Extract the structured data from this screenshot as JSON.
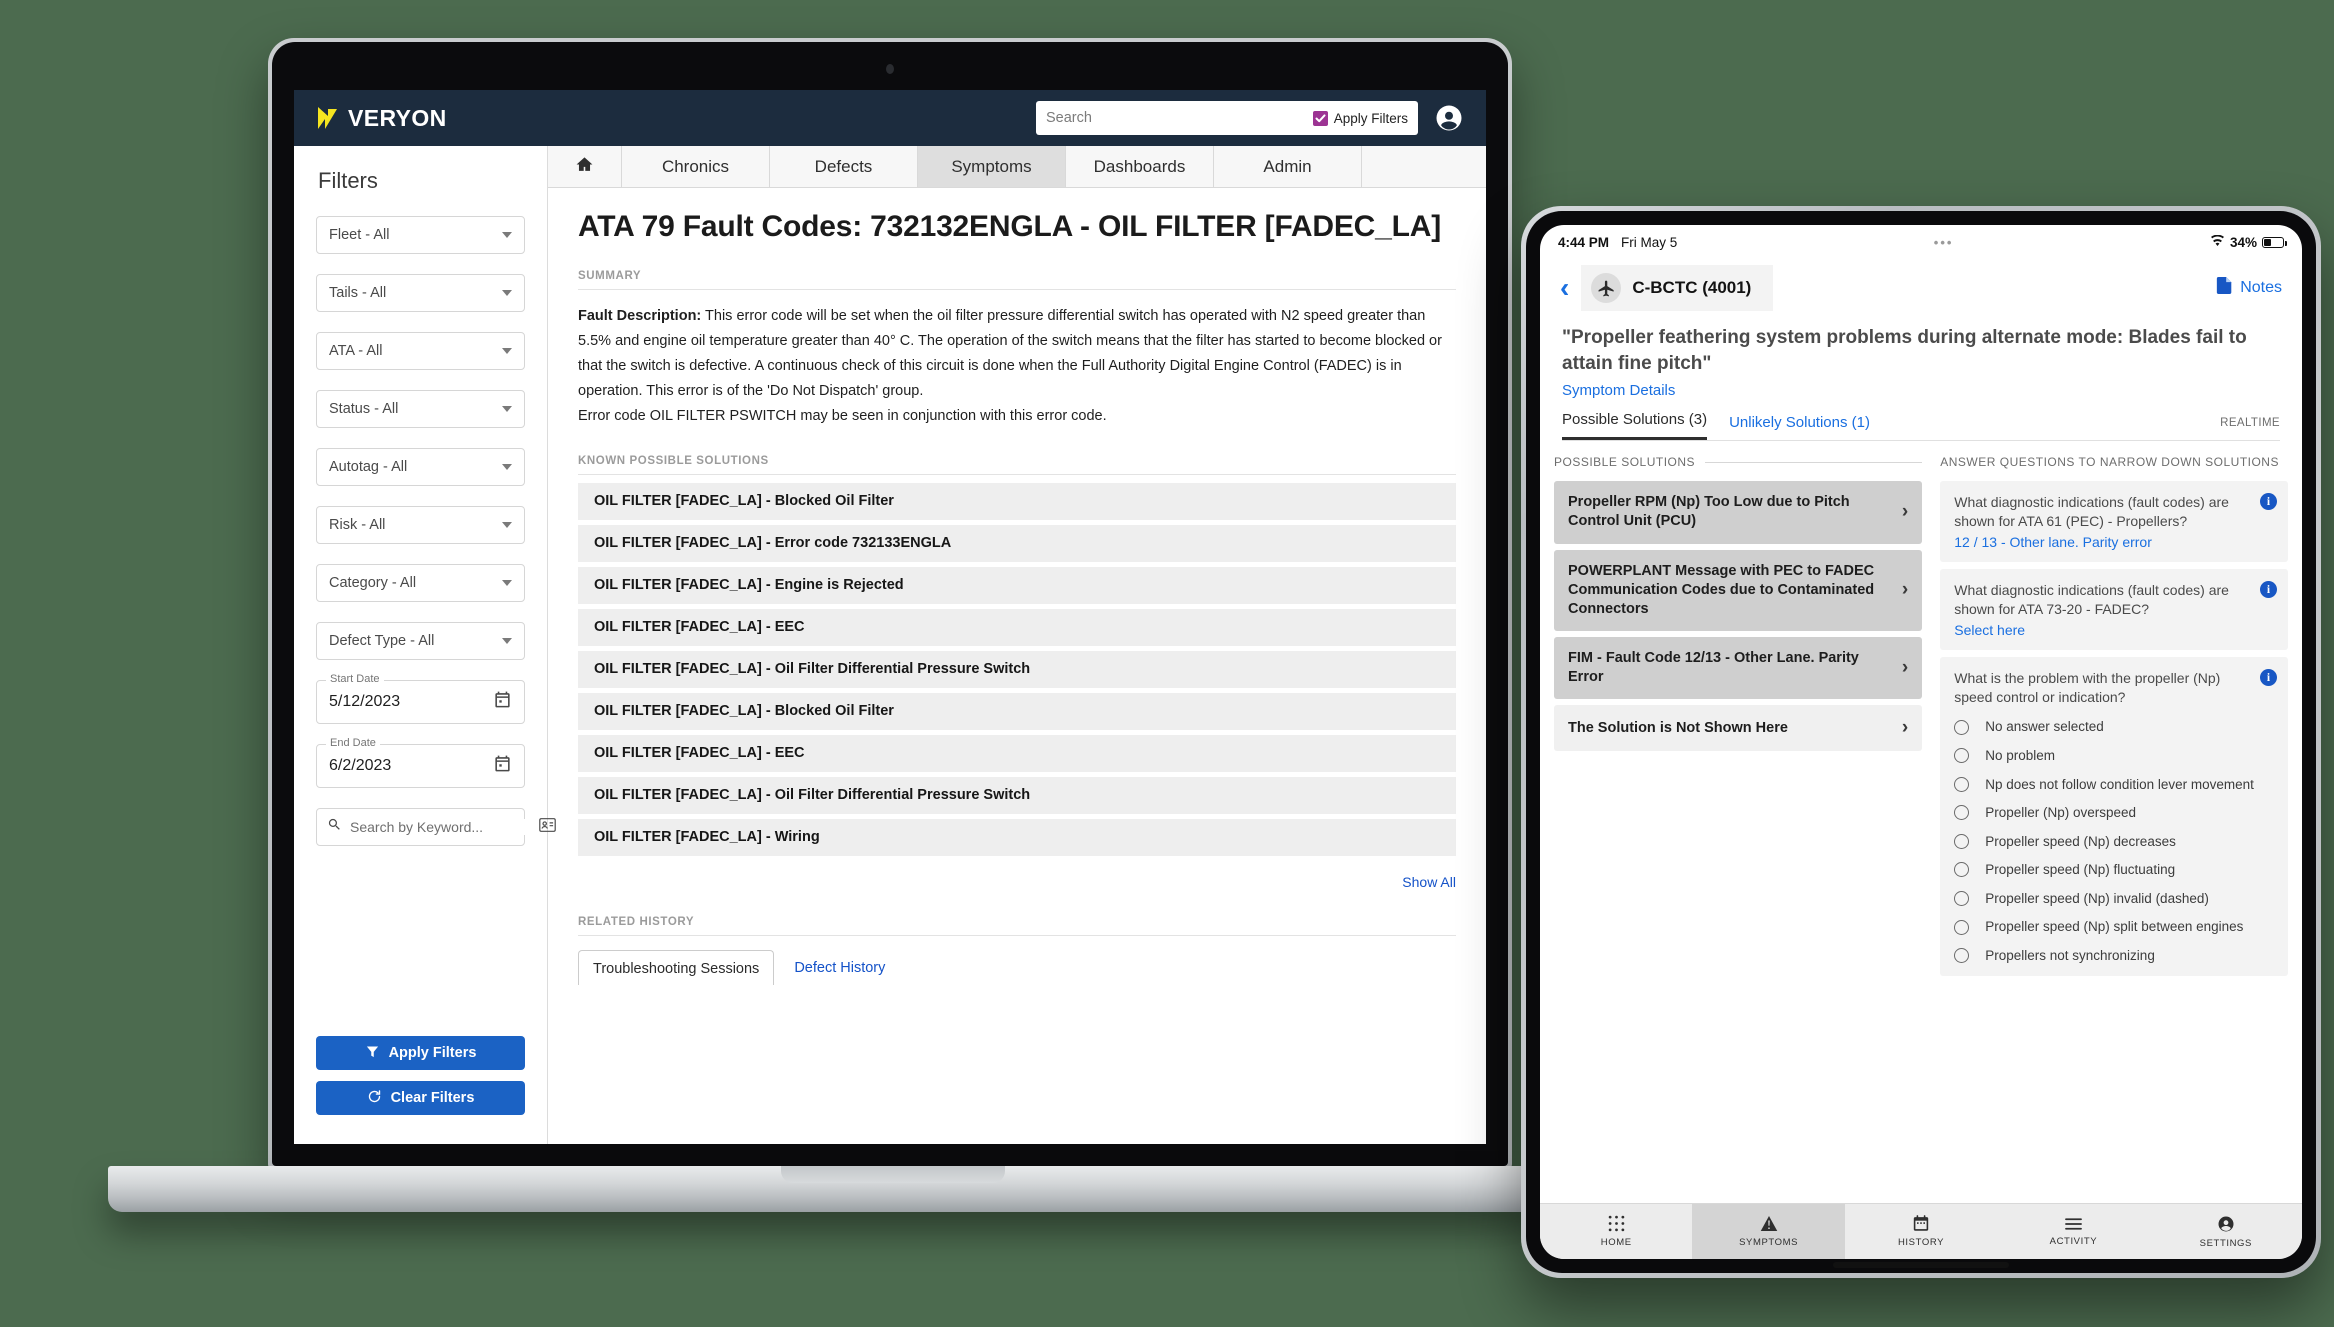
{
  "colors": {
    "background": "#4c6b4f",
    "topbar": "#1c2c3e",
    "brand_yellow": "#f5e520",
    "primary_blue": "#1b62c4",
    "link_blue": "#1452c8",
    "checkbox_purple": "#9c3393"
  },
  "desktop": {
    "brand": "VERYON",
    "search": {
      "placeholder": "Search",
      "value": ""
    },
    "apply_filters_checkbox": {
      "label": "Apply Filters",
      "checked": true
    },
    "account_icon": "account-circle-icon",
    "nav_tabs": [
      {
        "label": "",
        "icon": "home-icon",
        "active": false
      },
      {
        "label": "Chronics",
        "active": false
      },
      {
        "label": "Defects",
        "active": false
      },
      {
        "label": "Symptoms",
        "active": true
      },
      {
        "label": "Dashboards",
        "active": false
      },
      {
        "label": "Admin",
        "active": false
      }
    ],
    "sidebar": {
      "title": "Filters",
      "selects": [
        "Fleet - All",
        "Tails - All",
        "ATA - All",
        "Status - All",
        "Autotag - All",
        "Risk - All",
        "Category - All",
        "Defect Type - All"
      ],
      "start_date": {
        "legend": "Start Date",
        "value": "5/12/2023"
      },
      "end_date": {
        "legend": "End Date",
        "value": "6/2/2023"
      },
      "keyword_search": {
        "placeholder": "Search by Keyword..."
      },
      "apply_button": "Apply Filters",
      "clear_button": "Clear Filters"
    },
    "page_title": "ATA 79 Fault Codes: 732132ENGLA - OIL FILTER [FADEC_LA]",
    "summary_label": "SUMMARY",
    "fault_description_label": "Fault Description:",
    "fault_description_body": " This error code will be set when the oil filter pressure differential switch has operated with N2 speed greater than 5.5% and engine oil temperature greater than 40° C. The operation of the switch means that the filter has started to become blocked or that the switch is defective. A continuous check of this circuit is done when the Full Authority Digital Engine Control (FADEC) is in operation. This error is of the 'Do Not Dispatch' group.",
    "fault_description_line2": "Error code OIL FILTER PSWITCH may be seen in conjunction with this error code.",
    "known_solutions_label": "KNOWN POSSIBLE SOLUTIONS",
    "known_solutions": [
      "OIL FILTER [FADEC_LA] - Blocked Oil Filter",
      "OIL FILTER [FADEC_LA] - Error code 732133ENGLA",
      "OIL FILTER [FADEC_LA] - Engine is Rejected",
      "OIL FILTER [FADEC_LA] - EEC",
      "OIL FILTER [FADEC_LA] - Oil Filter Differential Pressure Switch",
      "OIL FILTER [FADEC_LA] - Blocked Oil Filter",
      "OIL FILTER [FADEC_LA] - EEC",
      "OIL FILTER [FADEC_LA] - Oil Filter Differential Pressure Switch",
      "OIL FILTER [FADEC_LA] - Wiring"
    ],
    "show_all_link": "Show All",
    "related_history_label": "RELATED HISTORY",
    "history_tabs": [
      {
        "label": "Troubleshooting Sessions",
        "active": true
      },
      {
        "label": "Defect History",
        "active": false
      }
    ]
  },
  "tablet": {
    "status_bar": {
      "time": "4:44 PM",
      "date": "Fri May 5",
      "dots": "•••",
      "battery": "34%",
      "wifi_icon": "wifi-icon"
    },
    "back_icon": "chevron-left-icon",
    "aircraft": {
      "label": "C-BCTC (4001)",
      "icon": "airplane-icon"
    },
    "notes": {
      "label": "Notes",
      "icon": "note-icon"
    },
    "title": "\"Propeller feathering system problems during alternate mode: Blades fail to attain fine pitch\"",
    "symptom_details_link": "Symptom Details",
    "tabs": [
      {
        "label": "Possible Solutions (3)",
        "active": true
      },
      {
        "label": "Unlikely Solutions (1)",
        "active": false
      }
    ],
    "realtime_label": "REALTIME",
    "possible_solutions_label": "POSSIBLE SOLUTIONS",
    "possible_solutions": [
      {
        "label": "Propeller RPM (Np) Too Low due to Pitch Control Unit (PCU)",
        "variant": "dark"
      },
      {
        "label": "POWERPLANT Message with PEC to FADEC Communication Codes due to Contaminated Connectors",
        "variant": "dark"
      },
      {
        "label": "FIM - Fault Code 12/13 - Other Lane. Parity Error",
        "variant": "dark"
      },
      {
        "label": "The Solution is Not Shown Here",
        "variant": "light"
      }
    ],
    "questions_label": "ANSWER QUESTIONS TO NARROW DOWN SOLUTIONS",
    "questions": [
      {
        "text": "What diagnostic indications (fault codes) are shown for ATA 61 (PEC) - Propellers?",
        "answer": "12 / 13 - Other lane. Parity error",
        "options": []
      },
      {
        "text": "What diagnostic indications (fault codes) are shown for ATA 73-20 - FADEC?",
        "answer": "Select here",
        "options": []
      },
      {
        "text": "What is the problem with the propeller (Np) speed control or indication?",
        "answer": "",
        "options": [
          "No answer selected",
          "No problem",
          "Np does not follow condition lever movement",
          "Propeller (Np) overspeed",
          "Propeller speed (Np) decreases",
          "Propeller speed (Np) fluctuating",
          "Propeller speed (Np) invalid (dashed)",
          "Propeller speed (Np) split between engines",
          "Propellers not synchronizing"
        ]
      }
    ],
    "bottom_nav": [
      {
        "label": "HOME",
        "icon": "grid-icon",
        "active": false
      },
      {
        "label": "SYMPTOMS",
        "icon": "warning-triangle-icon",
        "active": true
      },
      {
        "label": "HISTORY",
        "icon": "calendar-icon",
        "active": false
      },
      {
        "label": "ACTIVITY",
        "icon": "list-icon",
        "active": false
      },
      {
        "label": "SETTINGS",
        "icon": "account-circle-icon",
        "active": false
      }
    ]
  }
}
